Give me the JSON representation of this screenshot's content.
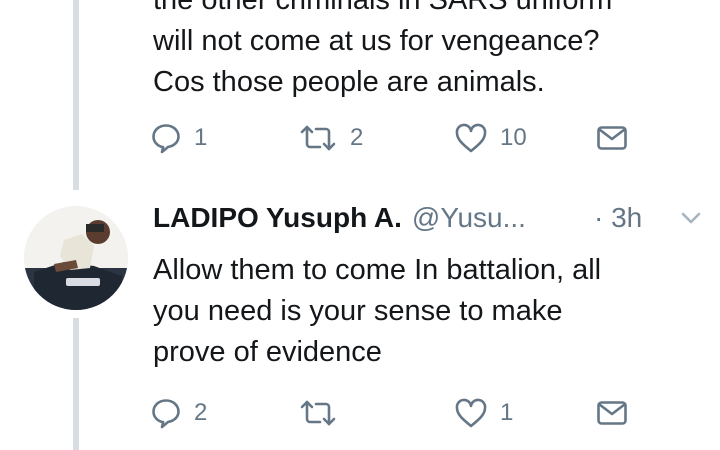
{
  "tweet1": {
    "text_lines": [
      "the other criminals in SARS uniform",
      "will not come at us for vengeance?",
      "Cos those people are animals."
    ],
    "actions": {
      "replies": "1",
      "retweets": "2",
      "likes": "10"
    }
  },
  "tweet2": {
    "author_name": "LADIPO Yusuph A.",
    "handle": "@Yusu...",
    "time": "· 3h",
    "text_lines": [
      "Allow them to come In battalion, all",
      "you need is your sense to make",
      "prove of evidence"
    ],
    "actions": {
      "replies": "2",
      "retweets": "",
      "likes": "1"
    }
  },
  "icons": {
    "reply": "reply-icon",
    "retweet": "retweet-icon",
    "like": "heart-icon",
    "message": "envelope-icon",
    "caret": "chevron-down-icon"
  },
  "colors": {
    "text": "#14171a",
    "muted": "#657786",
    "thread_line": "#d6dde3"
  }
}
